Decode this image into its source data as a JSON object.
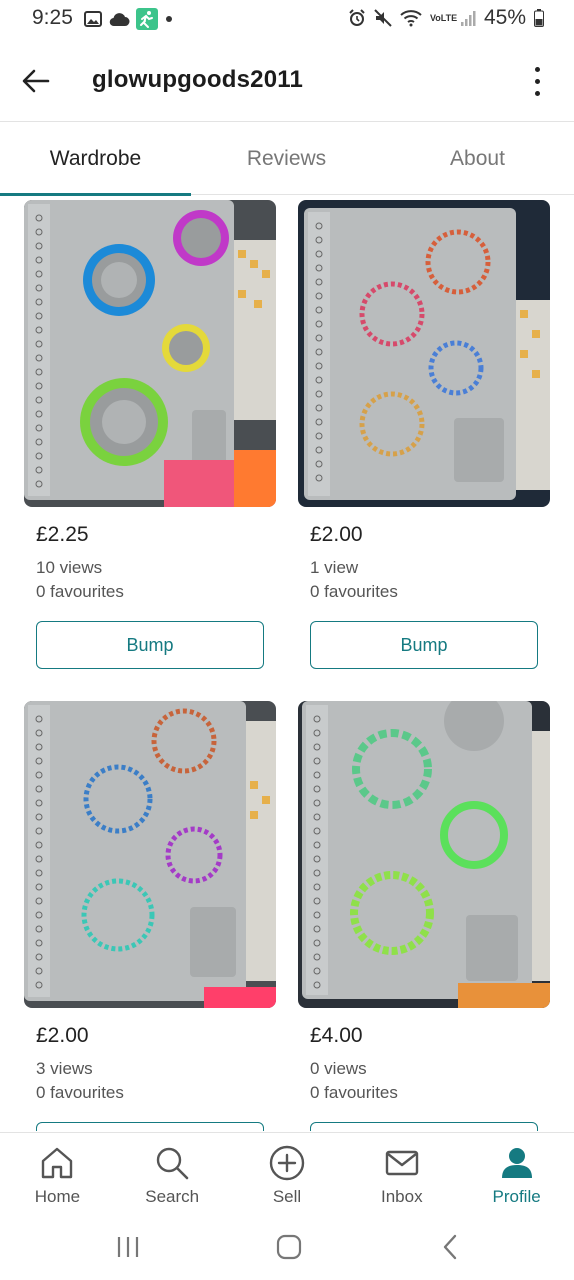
{
  "status_bar": {
    "time": "9:25",
    "battery": "45%",
    "network": "VoLTE"
  },
  "header": {
    "title": "glowupgoods2011"
  },
  "tabs": [
    {
      "label": "Wardrobe",
      "active": true
    },
    {
      "label": "Reviews",
      "active": false
    },
    {
      "label": "About",
      "active": false
    }
  ],
  "items": [
    {
      "price": "£2.25",
      "views": "10 views",
      "favourites": "0 favourites",
      "action": "Bump"
    },
    {
      "price": "£2.00",
      "views": "1 view",
      "favourites": "0 favourites",
      "action": "Bump"
    },
    {
      "price": "£2.00",
      "views": "3 views",
      "favourites": "0 favourites",
      "action": ""
    },
    {
      "price": "£4.00",
      "views": "0 views",
      "favourites": "0 favourites",
      "action": ""
    }
  ],
  "bottom_nav": [
    {
      "label": "Home",
      "icon": "home-icon"
    },
    {
      "label": "Search",
      "icon": "search-icon"
    },
    {
      "label": "Sell",
      "icon": "plus-circle-icon"
    },
    {
      "label": "Inbox",
      "icon": "mail-icon"
    },
    {
      "label": "Profile",
      "icon": "person-icon",
      "active": true
    }
  ],
  "colors": {
    "accent": "#157a81",
    "tray": "#b9bcbd",
    "background": "#ffffff"
  }
}
